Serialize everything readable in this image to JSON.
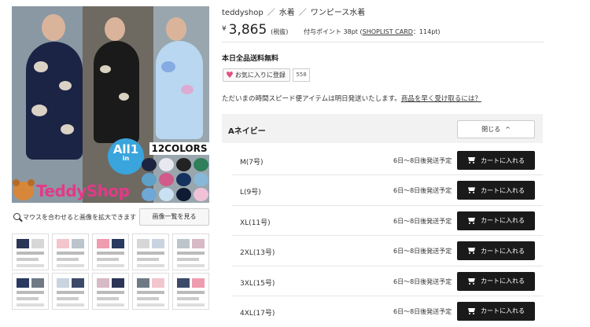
{
  "breadcrumb": [
    "teddyshop",
    "水着",
    "ワンピース水着"
  ],
  "price": {
    "currency": "¥",
    "amount": "3,865",
    "tax_note": "(税抜)",
    "points_prefix": "付与ポイント  38pt (",
    "points_card": "SHOPLIST CARD",
    "points_suffix": "：114pt)"
  },
  "shipping_free": "本日全品送料無料",
  "favorite": {
    "label": "お気に入りに登録",
    "count": "558"
  },
  "notice": {
    "text": "ただいまの時間スピード便アイテムは明日発送いたします。",
    "link": "商品を早く受け取るには？"
  },
  "variant": {
    "name": "Aネイビー",
    "close_label": "閉じる"
  },
  "sizes": [
    {
      "label": "M(7号)",
      "ship": "6日〜8日後発送予定",
      "cart": "カートに入れる"
    },
    {
      "label": "L(9号)",
      "ship": "6日〜8日後発送予定",
      "cart": "カートに入れる"
    },
    {
      "label": "XL(11号)",
      "ship": "6日〜8日後発送予定",
      "cart": "カートに入れる"
    },
    {
      "label": "2XL(13号)",
      "ship": "6日〜8日後発送予定",
      "cart": "カートに入れる"
    },
    {
      "label": "3XL(15号)",
      "ship": "6日〜8日後発送予定",
      "cart": "カートに入れる"
    },
    {
      "label": "4XL(17号)",
      "ship": "6日〜8日後発送予定",
      "cart": "カートに入れる"
    }
  ],
  "gallery": {
    "zoom_hint": "マウスを合わせると画像を拡大できます",
    "image_list_button": "画像一覧を見る",
    "badge_all": "All",
    "badge_in": "in",
    "badge_one": "1",
    "colors_text": "12COLORS",
    "logo_text": "TeddyShop",
    "swatch_colors": [
      "#1c2440",
      "#e8e8f0",
      "#222222",
      "#2e7f5a",
      "#5fa0c8",
      "#d05a8a",
      "#15315e",
      "#88b8d8",
      "#6fa7d6",
      "#c9e1f2",
      "#0f1a33",
      "#f0c2d8"
    ],
    "thumb_count": 10
  },
  "colors": {
    "accent_pink": "#e23a87",
    "cart_bg": "#1a1a1a",
    "badge_blue": "#3aa4dc"
  }
}
